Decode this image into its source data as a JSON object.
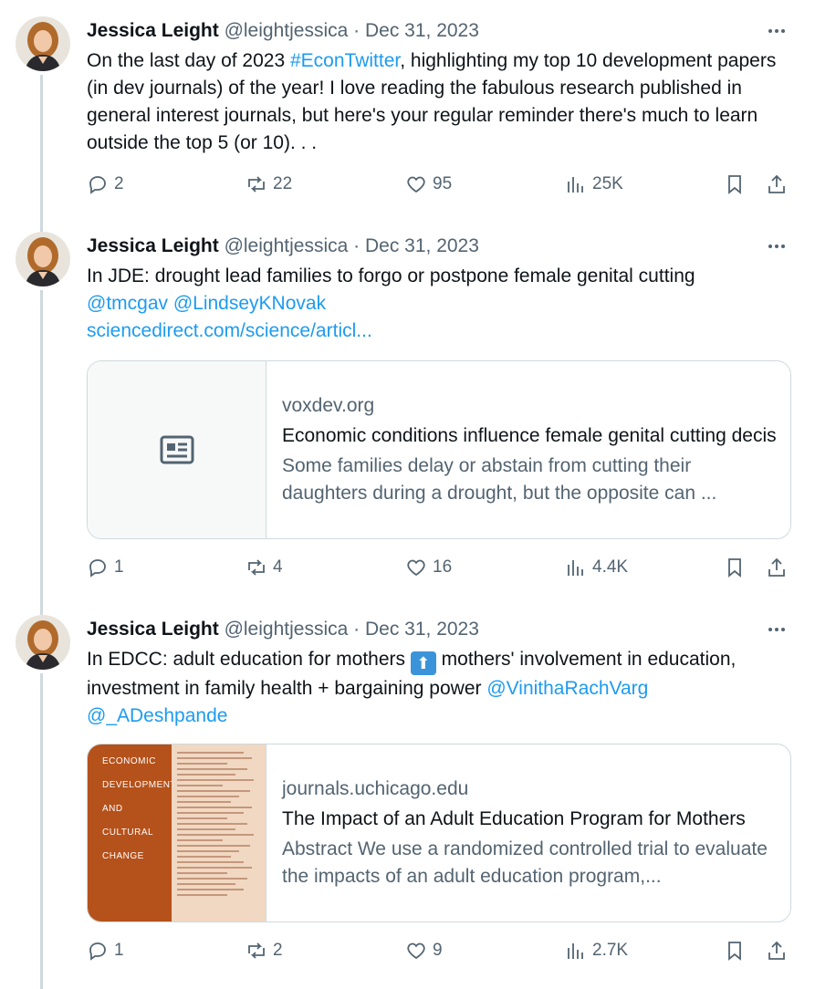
{
  "tweets": [
    {
      "name": "Jessica Leight",
      "handle": "@leightjessica",
      "separator": "·",
      "date": "Dec 31, 2023",
      "text_parts": [
        "On the last day of 2023 ",
        "#EconTwitter",
        ", highlighting my top 10 development papers (in dev journals) of the year!   I love reading the fabulous research published in general interest journals, but here's your regular reminder there's much to learn outside the top 5 (or 10). . ."
      ],
      "replies": "2",
      "reposts": "22",
      "likes": "95",
      "views": "25K"
    },
    {
      "name": "Jessica Leight",
      "handle": "@leightjessica",
      "separator": "·",
      "date": "Dec 31, 2023",
      "text_line1": "In JDE: drought lead families to forgo or postpone female genital cutting",
      "mentions": "@tmcgav @LindseyKNovak",
      "link": "sciencedirect.com/science/articl...",
      "card": {
        "domain": "voxdev.org",
        "title": "Economic conditions influence female genital cutting decisions",
        "description": "Some families delay or abstain from cutting their daughters during a drought, but the opposite can ..."
      },
      "replies": "1",
      "reposts": "4",
      "likes": "16",
      "views": "4.4K"
    },
    {
      "name": "Jessica Leight",
      "handle": "@leightjessica",
      "separator": "·",
      "date": "Dec 31, 2023",
      "text_a": "In EDCC: adult education for mothers ",
      "emoji": "⬆",
      "text_b": " mothers' involvement in education, investment in family health + bargaining power ",
      "mention1": "@VinithaRachVarg",
      "mention2": "@_ADeshpande",
      "card": {
        "domain": "journals.uchicago.edu",
        "title": "The Impact of an Adult Education Program for Mothers",
        "description": "Abstract We use a randomized controlled trial to evaluate the impacts of an adult education program,...",
        "cover_words": [
          "ECONOMIC",
          "DEVELOPMENT",
          "AND",
          "CULTURAL",
          "CHANGE"
        ]
      },
      "replies": "1",
      "reposts": "2",
      "likes": "9",
      "views": "2.7K"
    }
  ],
  "colors": {
    "link": "#1d9bf0",
    "muted": "#536471",
    "text": "#0f1419",
    "border": "#cfd9de"
  }
}
